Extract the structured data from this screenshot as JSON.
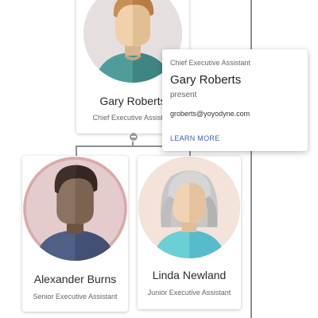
{
  "nodes": {
    "top": {
      "name": "Gary Roberts",
      "title": "Chief Executive Assistant",
      "avatar_bg": "#e6dfdf",
      "ring": "#d7cfcf"
    },
    "left": {
      "name": "Alexander Burns",
      "title": "Senior Executive Assistant",
      "avatar_bg": "#e3cccb",
      "ring": "#d9a9a8"
    },
    "right": {
      "name": "Linda Newland",
      "title": "Junior Executive Assistant",
      "avatar_bg": "#f3e3da",
      "ring": "#eed2c4"
    }
  },
  "popup": {
    "title": "Chief Executive Assistant",
    "name": "Gary Roberts",
    "status": "present",
    "email": "groberts@yoyodyne.com",
    "learn_more": "LEARN MORE"
  },
  "colors": {
    "connector": "#8f8f8f",
    "link": "#3d5fb6"
  }
}
